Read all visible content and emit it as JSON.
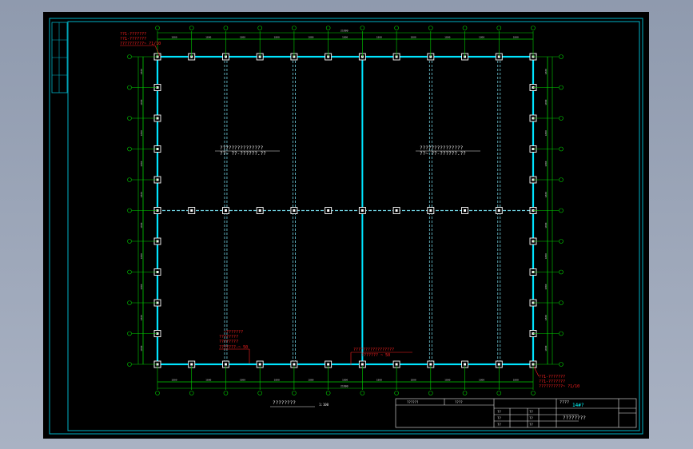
{
  "window": {
    "viewport_background": "#000000",
    "outer_background": "#a3acbe"
  },
  "colors": {
    "frame": "#00b4c8",
    "column": "#ffffff",
    "beam_main": "#00e5ff",
    "beam_secondary": "#6fd0e0",
    "grid_green": "#00d000",
    "dim_text": "#d0d0d0",
    "annotation_red": "#ff2020",
    "annotation_white": "#e8e8e8",
    "title_accent": "#00ffff"
  },
  "plan": {
    "column_count_x": 12,
    "column_count_y": 11,
    "top_dim_labels": [
      "1800",
      "1800",
      "1800",
      "1800",
      "1800",
      "1800",
      "1800",
      "1800",
      "1800",
      "1800",
      "1800"
    ],
    "top_total": "21600",
    "bottom_dim_labels": [
      "1800",
      "1800",
      "1800",
      "1800",
      "1800",
      "1800",
      "1800",
      "1800",
      "1800",
      "1800",
      "1800"
    ],
    "bottom_total": "21600",
    "left_dim_labels": [
      "1800",
      "1800",
      "1800",
      "1800",
      "1800",
      "1800",
      "1800",
      "1800",
      "1800",
      "1800"
    ],
    "right_dim_labels": [
      "1800",
      "1800",
      "1800",
      "1800",
      "1800",
      "1800",
      "1800",
      "1800",
      "1800",
      "1800"
    ]
  },
  "annotations": {
    "top_left_red_1": "??1-???????",
    "top_left_red_2": "??1-???????",
    "top_left_red_3": "??????????~ ?1/10",
    "center_left_white_1": "???????????????",
    "center_left_white_2": "??~ ??-??????.??",
    "center_right_white_1": "???????????????",
    "center_right_white_2": "??~ ??-??????.??",
    "bottom_left_red_1": "~???????",
    "bottom_left_red_2": "????????",
    "bottom_left_red_3": "????????",
    "bottom_left_red_4": "???????-~ 50",
    "bottom_center_red_1": "?????????????????",
    "bottom_center_red_2": "??????? ~ 50",
    "bottom_right_red_1": "??1-???????",
    "bottom_right_red_2": "??1-???????",
    "bottom_right_red_3": "??????????~ ?1/10"
  },
  "plan_title": {
    "label": "????????",
    "scale": "1:100"
  },
  "title_block": {
    "cells_top": [
      "??????",
      "????"
    ],
    "company": "????",
    "project_code": "14#?",
    "drawing_name": "????????",
    "rows_left": [
      "??",
      "??",
      "??"
    ],
    "rows_mid": [
      "??",
      "??",
      "??"
    ]
  }
}
